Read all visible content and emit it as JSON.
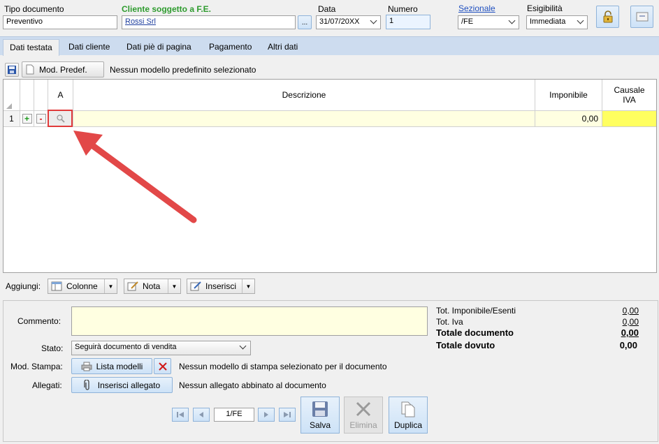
{
  "header": {
    "tipo_documento_label": "Tipo documento",
    "tipo_documento_value": "Preventivo",
    "cliente_label": "Cliente soggetto a F.E.",
    "cliente_value": "Rossi Srl",
    "browse_label": "...",
    "data_label": "Data",
    "data_value": "31/07/20XX",
    "numero_label": "Numero",
    "numero_value": "1",
    "sezionale_label": "Sezionale",
    "sezionale_value": "/FE",
    "esigibilita_label": "Esigibilità",
    "esigibilita_value": "Immediata"
  },
  "tabs": [
    {
      "label": "Dati testata"
    },
    {
      "label": "Dati cliente"
    },
    {
      "label": "Dati piè di pagina"
    },
    {
      "label": "Pagamento"
    },
    {
      "label": "Altri dati"
    }
  ],
  "model_bar": {
    "mod_predef_label": "Mod. Predef.",
    "status_text": "Nessun modello predefinito selezionato"
  },
  "grid": {
    "headers": {
      "a": "A",
      "descrizione": "Descrizione",
      "imponibile": "Imponibile",
      "causale_iva": "Causale IVA"
    },
    "rows": [
      {
        "num": "1",
        "add": "+",
        "remove": "-",
        "descrizione": "",
        "imponibile": "0,00",
        "causale_iva": ""
      }
    ]
  },
  "aggiungi": {
    "label": "Aggiungi:",
    "colonne": "Colonne",
    "nota": "Nota",
    "inserisci": "Inserisci"
  },
  "form": {
    "commento_label": "Commento:",
    "commento_value": "",
    "stato_label": "Stato:",
    "stato_value": "Seguirà documento di vendita",
    "mod_stampa_label": "Mod. Stampa:",
    "lista_modelli": "Lista modelli",
    "mod_stampa_status": "Nessun modello di stampa selezionato per il documento",
    "allegati_label": "Allegati:",
    "inserisci_allegato": "Inserisci allegato",
    "allegati_status": "Nessun allegato abbinato al documento"
  },
  "totals": {
    "tot_imponibile_label": "Tot. Imponibile/Esenti",
    "tot_imponibile_value": "0,00",
    "tot_iva_label": "Tot. Iva",
    "tot_iva_value": "0,00",
    "totale_documento_label": "Totale documento",
    "totale_documento_value": "0,00",
    "totale_dovuto_label": "Totale dovuto",
    "totale_dovuto_value": "0,00"
  },
  "navigation": {
    "page_value": "1/FE",
    "salva": "Salva",
    "elimina": "Elimina",
    "duplica": "Duplica"
  },
  "colors": {
    "accent": "#2e9b2e",
    "highlight_red": "#e03a3a",
    "arrow": "#e24848",
    "tab_bar": "#cddcef",
    "grid_row_yellow": "#ffffe1",
    "causale_yellow": "#ffff60"
  }
}
